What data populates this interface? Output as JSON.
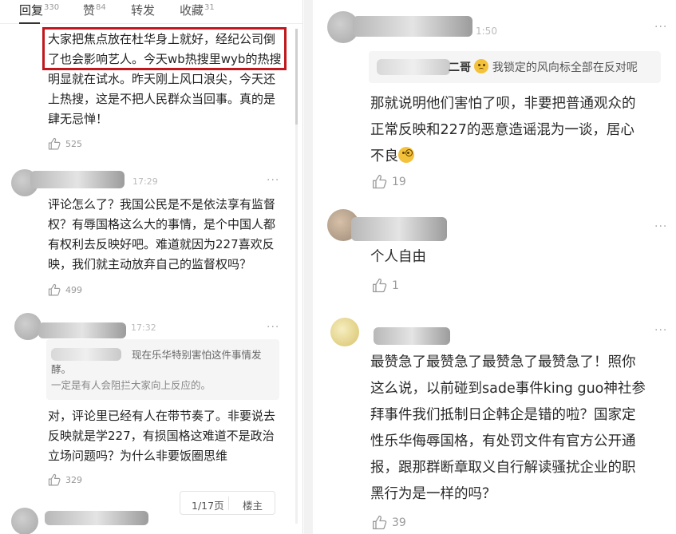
{
  "tabs": [
    {
      "label": "回复",
      "count": "330"
    },
    {
      "label": "赞",
      "count": "84"
    },
    {
      "label": "转发",
      "count": ""
    },
    {
      "label": "收藏",
      "count": "31"
    }
  ],
  "left_comments": [
    {
      "time": "",
      "text_lines": [
        "大家把焦点放在杜华身上就好，经纪公司倒",
        "了也会影响艺人。今天wb热搜里wyb的热搜",
        "明显就在试水。昨天刚上风口浪尖，今天还",
        "上热搜，这是不把人民群众当回事。真的是",
        "肆无忌惮！"
      ],
      "likes": "525"
    },
    {
      "time": "17:29",
      "text_lines": [
        "评论怎么了？我国公民是不是依法享有监督",
        "权？有辱国格这么大的事情，是个中国人都",
        "有权利去反映好吧。难道就因为227喜欢反",
        "映，我们就主动放弃自己的监督权吗？"
      ],
      "likes": "499"
    },
    {
      "time": "17:32",
      "quote_lines": [
        "现在乐华特别害怕这件事情发",
        "酵。",
        "一定是有人会阻拦大家向上反应的。"
      ],
      "text_lines": [
        "对，评论里已经有人在带节奏了。非要说去",
        "反映就是学227，有损国格这难道不是政治",
        "立场问题吗？为什么非要饭圈思维"
      ],
      "likes": "329"
    }
  ],
  "pager": {
    "page": "1/17页",
    "owner": "楼主"
  },
  "right_comments": [
    {
      "time": "1:50",
      "quote_name": "二哥",
      "quote_text": "我锁定的风向标全部在反对呢",
      "text_lines": [
        "那就说明他们害怕了呗，非要把普通观众的",
        "正常反映和227的恶意造谣混为一谈，居心",
        "不良"
      ],
      "likes": "19"
    },
    {
      "time": "",
      "text_lines": [
        "个人自由"
      ],
      "likes": "1"
    },
    {
      "time": "",
      "text_lines": [
        "最赞急了最赞急了最赞急了最赞急了！照你",
        "这么说，以前碰到sade事件king guo神社参",
        "拜事件我们抵制日企韩企是错的啦？国家定",
        "性乐华侮辱国格，有处罚文件有官方公开通",
        "报，跟那群断章取义自行解读骚扰企业的职",
        "黑行为是一样的吗？"
      ],
      "likes": "39"
    }
  ],
  "colors": {
    "highlight": "#c0181e",
    "text": "#222222",
    "muted": "#999999"
  }
}
